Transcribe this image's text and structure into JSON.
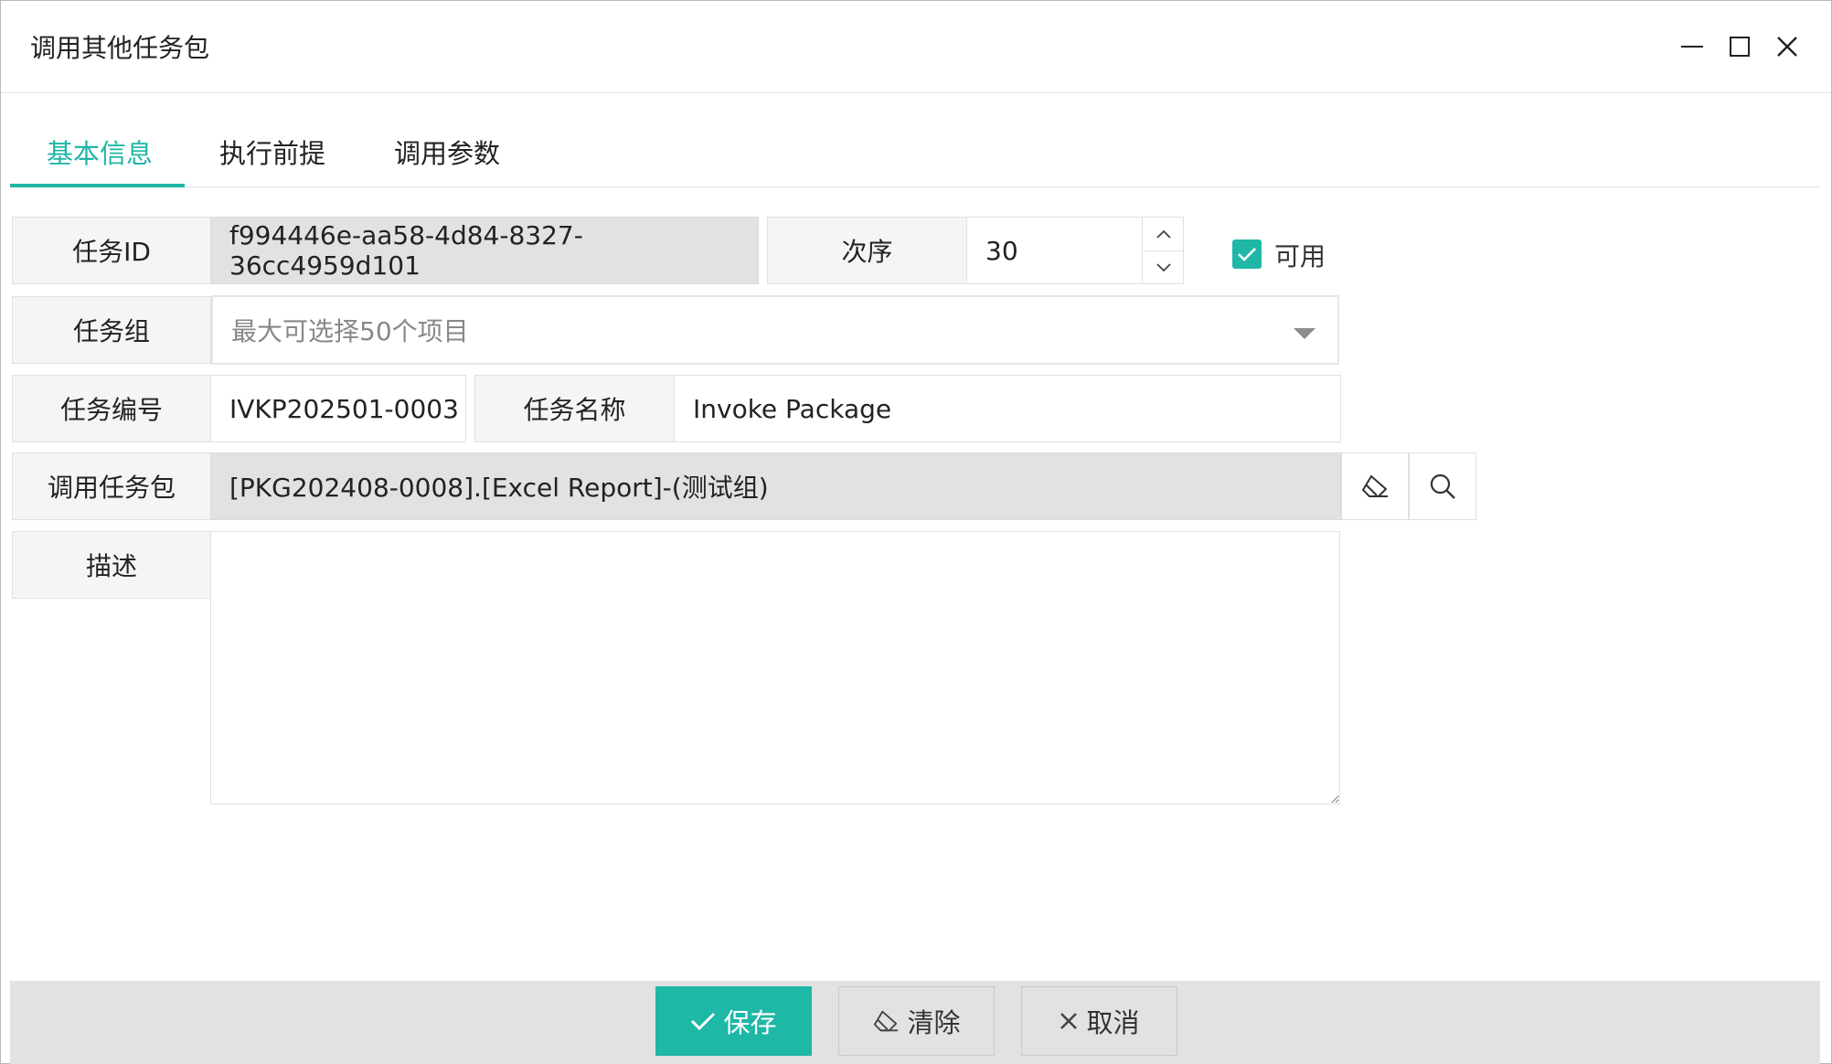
{
  "window": {
    "title": "调用其他任务包",
    "controls": [
      "minimize-icon",
      "maximize-icon",
      "close-icon"
    ]
  },
  "tabs": [
    {
      "label": "基本信息",
      "active": true
    },
    {
      "label": "执行前提",
      "active": false
    },
    {
      "label": "调用参数",
      "active": false
    }
  ],
  "form": {
    "task_id": {
      "label": "任务ID",
      "value": "f994446e-aa58-4d84-8327-36cc4959d101"
    },
    "order": {
      "label": "次序",
      "value": "30"
    },
    "enabled": {
      "label": "可用",
      "checked": true
    },
    "task_group": {
      "label": "任务组",
      "placeholder": "最大可选择50个项目"
    },
    "task_code": {
      "label": "任务编号",
      "value": "IVKP202501-0003"
    },
    "task_name": {
      "label": "任务名称",
      "value": "Invoke Package"
    },
    "invoke_package": {
      "label": "调用任务包",
      "value": "[PKG202408-0008].[Excel Report]-(测试组)"
    },
    "description": {
      "label": "描述",
      "value": ""
    }
  },
  "footer": {
    "save_label": "保存",
    "clear_label": "清除",
    "cancel_label": "取消"
  },
  "colors": {
    "accent": "#1fb7a6",
    "readonly_bg": "#e2e2e2",
    "label_bg": "#f5f5f5"
  }
}
